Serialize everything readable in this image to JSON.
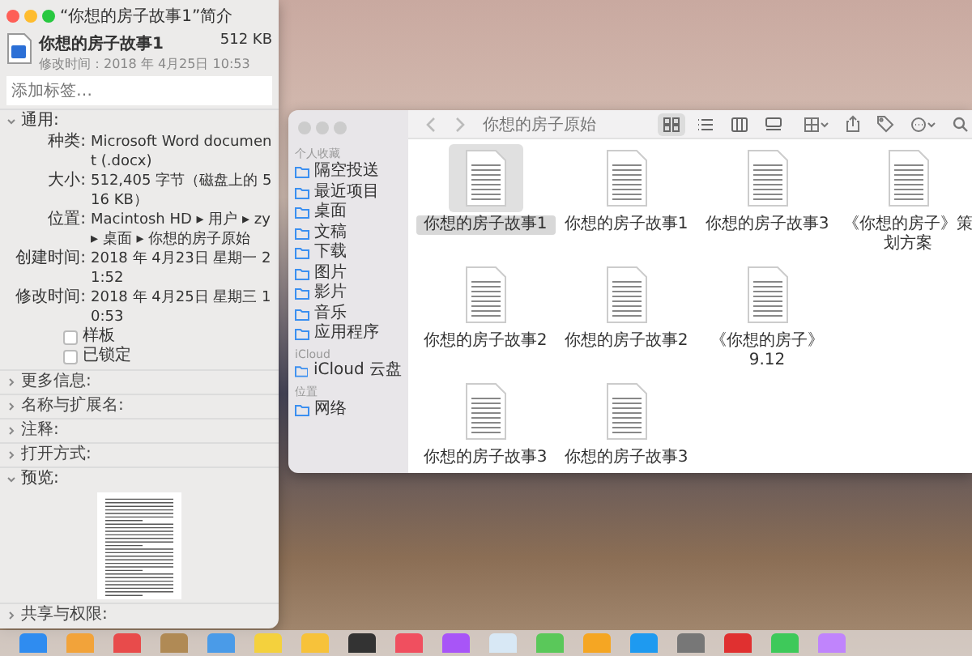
{
  "info_window": {
    "title": "“你想的房子故事1”简介",
    "file_name": "你想的房子故事1",
    "file_size": "512 KB",
    "modified": "修改时间：2018 年 4月25日 10:53",
    "tags": {
      "placeholder": "添加标签…"
    },
    "sections": [
      {
        "kind": "general",
        "label": "通用:",
        "expanded": true,
        "rows": [
          {
            "label": "种类:",
            "value": "Microsoft Word document (.docx)"
          },
          {
            "label": "大小:",
            "value": "512,405 字节（磁盘上的 516 KB）"
          },
          {
            "label": "位置:",
            "value": "Macintosh HD ▸ 用户 ▸ zy ▸ 桌面 ▸ 你想的房子原始"
          },
          {
            "label": "创建时间:",
            "value": "2018 年 4月23日 星期一 21:52"
          },
          {
            "label": "修改时间:",
            "value": "2018 年 4月25日 星期三 10:53"
          }
        ],
        "checkboxes": [
          {
            "label": "样板",
            "checked": false
          },
          {
            "label": "已锁定",
            "checked": false
          }
        ]
      },
      {
        "kind": "plain",
        "label": "更多信息:",
        "expanded": false
      },
      {
        "kind": "plain",
        "label": "名称与扩展名:",
        "expanded": false
      },
      {
        "kind": "plain",
        "label": "注释:",
        "expanded": false
      },
      {
        "kind": "plain",
        "label": "打开方式:",
        "expanded": false
      },
      {
        "kind": "preview",
        "label": "预览:",
        "expanded": true
      },
      {
        "kind": "plain",
        "label": "共享与权限:",
        "expanded": false
      }
    ]
  },
  "finder": {
    "title": "你想的房子原始",
    "view_buttons": [
      {
        "selected": true
      },
      {
        "selected": false
      },
      {
        "selected": false
      },
      {
        "selected": false
      }
    ],
    "sidebar": [
      {
        "heading": "个人收藏",
        "items": [
          {
            "label": "隔空投送"
          },
          {
            "label": "最近项目"
          },
          {
            "label": "桌面"
          },
          {
            "label": "文稿"
          },
          {
            "label": "下载"
          },
          {
            "label": "图片"
          },
          {
            "label": "影片"
          },
          {
            "label": "音乐"
          },
          {
            "label": "应用程序"
          }
        ]
      },
      {
        "heading": "iCloud",
        "items": [
          {
            "label": "iCloud 云盘"
          }
        ]
      },
      {
        "heading": "位置",
        "items": [
          {
            "label": "网络"
          }
        ]
      }
    ],
    "files": [
      [
        {
          "name": "你想的房子故事1",
          "selected": true
        },
        {
          "name": "你想的房子故事1",
          "selected": false
        },
        {
          "name": "你想的房子故事3",
          "selected": false
        },
        {
          "name": "《你想的房子》策划方案",
          "selected": false
        }
      ],
      [
        {
          "name": "你想的房子故事2",
          "selected": false
        },
        {
          "name": "你想的房子故事2",
          "selected": false
        },
        {
          "name": "《你想的房子》9.12",
          "selected": false
        }
      ],
      [
        {
          "name": "你想的房子故事3",
          "selected": false
        },
        {
          "name": "你想的房子故事3",
          "selected": false
        }
      ]
    ]
  }
}
